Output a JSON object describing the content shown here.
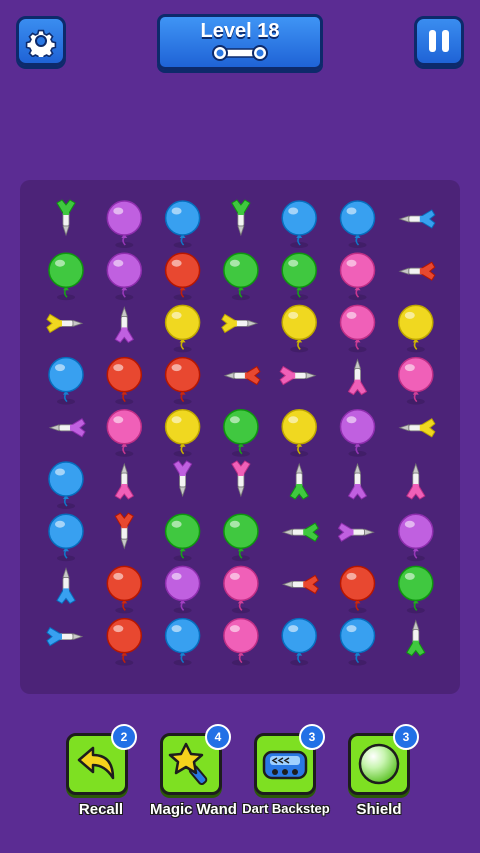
{
  "header": {
    "level_title": "Level 18",
    "progress_icon": "bone-shaped-progress-icon",
    "settings_icon": "gear-icon",
    "pause_icon": "pause-icon"
  },
  "colors": {
    "pink": "#f060b8",
    "purple": "#c060e0",
    "blue": "#38a0f0",
    "green": "#40c840",
    "red": "#e84830",
    "yellow": "#f0d820"
  },
  "board": {
    "rows": [
      [
        {
          "t": "dart",
          "c": "green",
          "d": "down"
        },
        {
          "t": "balloon",
          "c": "purple"
        },
        {
          "t": "balloon",
          "c": "blue"
        },
        {
          "t": "dart",
          "c": "green",
          "d": "down"
        },
        {
          "t": "balloon",
          "c": "blue"
        },
        {
          "t": "balloon",
          "c": "blue"
        },
        {
          "t": "dart",
          "c": "blue",
          "d": "left"
        }
      ],
      [
        {
          "t": "balloon",
          "c": "green"
        },
        {
          "t": "balloon",
          "c": "purple"
        },
        {
          "t": "balloon",
          "c": "red"
        },
        {
          "t": "balloon",
          "c": "green"
        },
        {
          "t": "balloon",
          "c": "green"
        },
        {
          "t": "balloon",
          "c": "pink"
        },
        {
          "t": "dart",
          "c": "red",
          "d": "left"
        }
      ],
      [
        {
          "t": "dart",
          "c": "yellow",
          "d": "right"
        },
        {
          "t": "dart",
          "c": "purple",
          "d": "up"
        },
        {
          "t": "balloon",
          "c": "yellow"
        },
        {
          "t": "dart",
          "c": "yellow",
          "d": "right"
        },
        {
          "t": "balloon",
          "c": "yellow"
        },
        {
          "t": "balloon",
          "c": "pink"
        },
        {
          "t": "balloon",
          "c": "yellow"
        }
      ],
      [
        {
          "t": "balloon",
          "c": "blue"
        },
        {
          "t": "balloon",
          "c": "red"
        },
        {
          "t": "balloon",
          "c": "red"
        },
        {
          "t": "dart",
          "c": "red",
          "d": "left"
        },
        {
          "t": "dart",
          "c": "pink",
          "d": "right"
        },
        {
          "t": "dart",
          "c": "pink",
          "d": "up"
        },
        {
          "t": "balloon",
          "c": "pink"
        }
      ],
      [
        {
          "t": "dart",
          "c": "purple",
          "d": "left"
        },
        {
          "t": "balloon",
          "c": "pink"
        },
        {
          "t": "balloon",
          "c": "yellow"
        },
        {
          "t": "balloon",
          "c": "green"
        },
        {
          "t": "balloon",
          "c": "yellow"
        },
        {
          "t": "balloon",
          "c": "purple"
        },
        {
          "t": "dart",
          "c": "yellow",
          "d": "left"
        }
      ],
      [
        {
          "t": "balloon",
          "c": "blue"
        },
        {
          "t": "dart",
          "c": "pink",
          "d": "up"
        },
        {
          "t": "dart",
          "c": "purple",
          "d": "down"
        },
        {
          "t": "dart",
          "c": "pink",
          "d": "down"
        },
        {
          "t": "dart",
          "c": "green",
          "d": "up"
        },
        {
          "t": "dart",
          "c": "purple",
          "d": "up"
        },
        {
          "t": "dart",
          "c": "pink",
          "d": "up"
        }
      ],
      [
        {
          "t": "balloon",
          "c": "blue"
        },
        {
          "t": "dart",
          "c": "red",
          "d": "down"
        },
        {
          "t": "balloon",
          "c": "green"
        },
        {
          "t": "balloon",
          "c": "green"
        },
        {
          "t": "dart",
          "c": "green",
          "d": "left"
        },
        {
          "t": "dart",
          "c": "purple",
          "d": "right"
        },
        {
          "t": "balloon",
          "c": "purple"
        }
      ],
      [
        {
          "t": "dart",
          "c": "blue",
          "d": "up"
        },
        {
          "t": "balloon",
          "c": "red"
        },
        {
          "t": "balloon",
          "c": "purple"
        },
        {
          "t": "balloon",
          "c": "pink"
        },
        {
          "t": "dart",
          "c": "red",
          "d": "left"
        },
        {
          "t": "balloon",
          "c": "red"
        },
        {
          "t": "balloon",
          "c": "green"
        }
      ],
      [
        {
          "t": "dart",
          "c": "blue",
          "d": "right"
        },
        {
          "t": "balloon",
          "c": "red"
        },
        {
          "t": "balloon",
          "c": "blue"
        },
        {
          "t": "balloon",
          "c": "pink"
        },
        {
          "t": "balloon",
          "c": "blue"
        },
        {
          "t": "balloon",
          "c": "blue"
        },
        {
          "t": "dart",
          "c": "green",
          "d": "up"
        }
      ]
    ]
  },
  "tools": [
    {
      "label": "Recall",
      "count": "2",
      "icon": "undo-arrow-icon"
    },
    {
      "label": "Magic Wand",
      "count": "4",
      "icon": "star-wand-icon"
    },
    {
      "label": "Dart Backstep",
      "count": "3",
      "icon": "conveyor-icon"
    },
    {
      "label": "Shield",
      "count": "3",
      "icon": "shield-bubble-icon"
    }
  ]
}
